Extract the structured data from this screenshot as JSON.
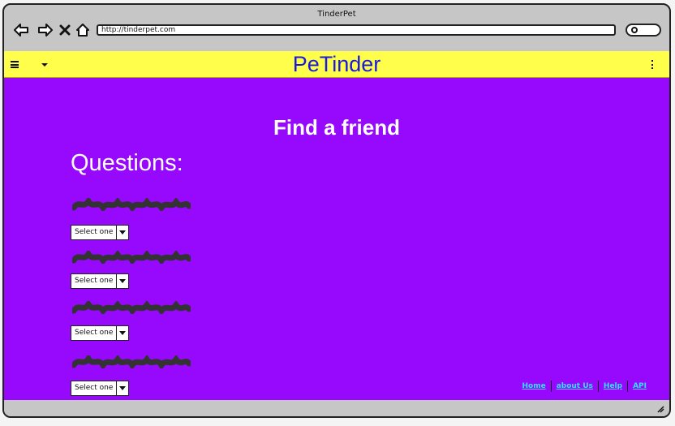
{
  "window": {
    "title": "TinderPet",
    "url": "http://tinderpet.com"
  },
  "toolbar": {
    "icons": [
      "back-arrow-icon",
      "forward-arrow-icon",
      "close-icon",
      "home-icon",
      "search-icon"
    ]
  },
  "appbar": {
    "brand": "PeTinder",
    "icons": [
      "hamburger-menu-icon",
      "dropdown-caret-icon",
      "kebab-menu-icon"
    ],
    "background": "#fffe4a",
    "brand_color": "#1a1ae0"
  },
  "main": {
    "heading": "Find a friend",
    "questions_title": "Questions:",
    "background": "#9609fc",
    "questions": [
      {
        "select_value": "Select one"
      },
      {
        "select_value": "Select one"
      },
      {
        "select_value": "Select one"
      },
      {
        "select_value": "Select one"
      }
    ]
  },
  "footer": {
    "links": [
      "Home",
      "about Us",
      "Help",
      "API"
    ],
    "link_color": "#34e0ff"
  }
}
